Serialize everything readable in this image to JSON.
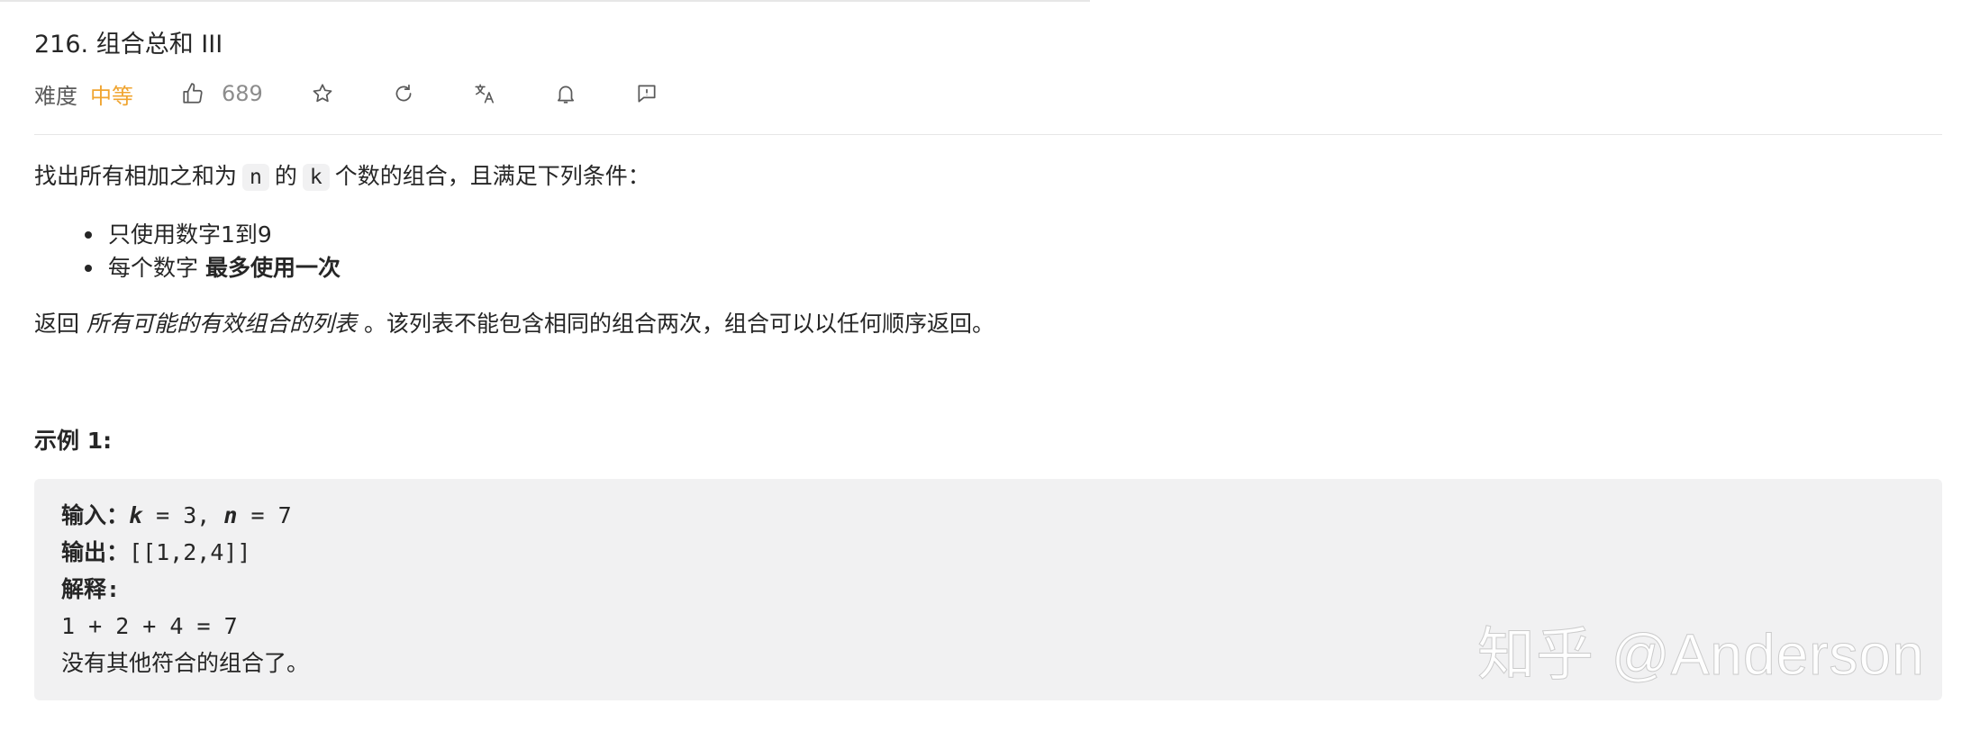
{
  "problem": {
    "title": "216. 组合总和 III",
    "difficulty_label": "难度",
    "difficulty": "中等",
    "likes": "689"
  },
  "icons": [
    "thumbs-up-icon",
    "star-icon",
    "refresh-icon",
    "translate-icon",
    "bell-icon",
    "feedback-icon"
  ],
  "colors": {
    "difficulty": "#f0a531",
    "code_bg": "#f1f1f2",
    "text": "#262626"
  },
  "description": {
    "intro_a": "找出所有相加之和为",
    "var_n": "n",
    "intro_b": "的",
    "var_k": "k",
    "intro_c": "个数的组合，且满足下列条件：",
    "conditions": [
      "只使用数字1到9",
      "每个数字"
    ],
    "condition2_bold": "最多使用一次",
    "return_a": "返回",
    "return_italic": "所有可能的有效组合的列表",
    "return_b": "。该列表不能包含相同的组合两次，组合可以以任何顺序返回。"
  },
  "example": {
    "title": "示例 1:",
    "input_label": "输入：",
    "input_k": "k",
    "input_mid": " = 3, ",
    "input_n": "n",
    "input_end": " = 7",
    "output_label": "输出：",
    "output_value": "[[1,2,4]]",
    "explain_label": "解释:",
    "explain_line1": "1 + 2 + 4 = 7",
    "explain_line2": "没有其他符合的组合了。"
  },
  "watermark": "知乎 @Anderson"
}
